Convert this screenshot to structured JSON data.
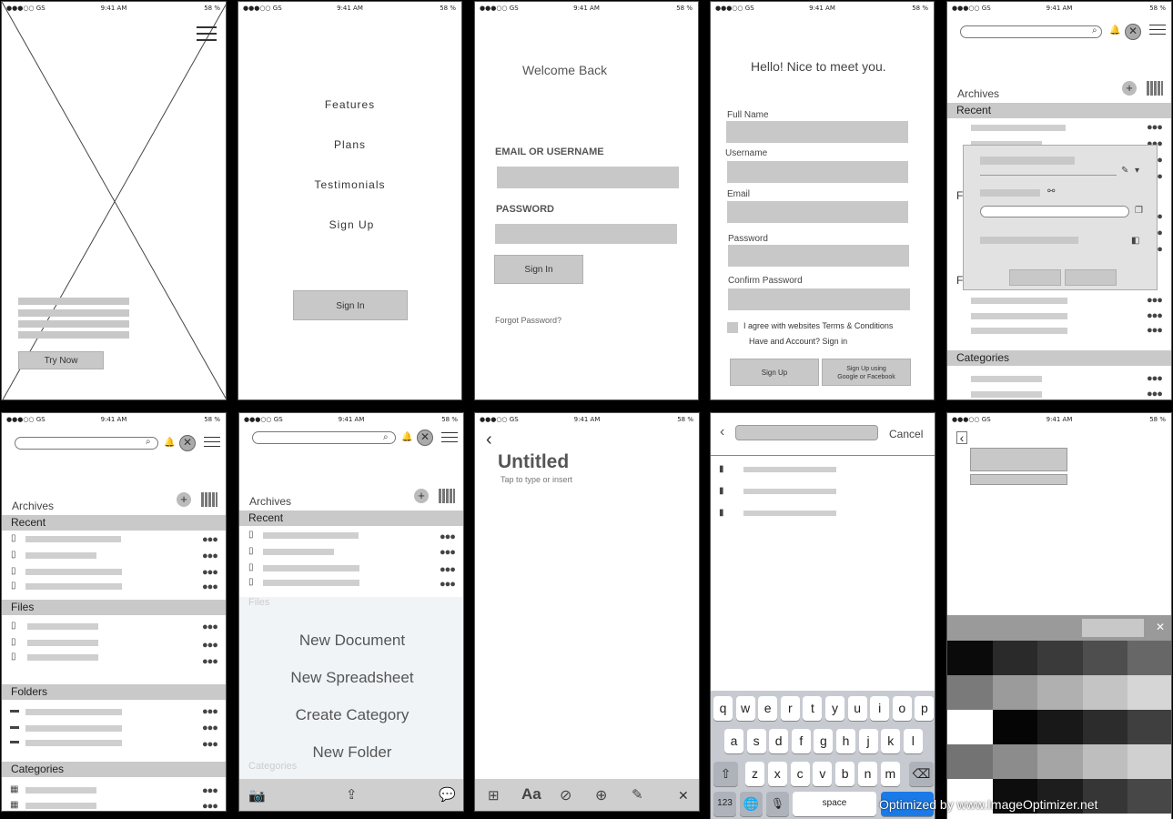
{
  "status": {
    "carrier": "●●●○○ GS",
    "time": "9:41 AM",
    "battery": "58 %"
  },
  "s1": {
    "try_now": "Try Now"
  },
  "s2": {
    "menu": [
      "Features",
      "Plans",
      "Testimonials",
      "Sign Up"
    ],
    "sign_in": "Sign In"
  },
  "s3": {
    "title": "Welcome Back",
    "email_label": "EMAIL OR USERNAME",
    "password_label": "PASSWORD",
    "sign_in": "Sign In",
    "forgot": "Forgot Password?"
  },
  "s4": {
    "title": "Hello! Nice to meet you.",
    "full_name": "Full Name",
    "username": "Username",
    "email": "Email",
    "password": "Password",
    "confirm": "Confirm Password",
    "agree": "I agree with websites Terms & Conditions",
    "have_account": "Have and Account? Sign in",
    "sign_up": "Sign Up",
    "sign_up_social": "Sign Up using\nGoogle or Facebook"
  },
  "archive": {
    "title": "Archives",
    "recent": "Recent",
    "files": "Files",
    "folders": "Folders",
    "categories": "Categories",
    "f_short": "F"
  },
  "s7": {
    "actions": [
      "New Document",
      "New Spreadsheet",
      "Create Category",
      "New Folder"
    ],
    "faded_files": "Files",
    "faded_categories": "Categories"
  },
  "s8": {
    "title": "Untitled",
    "hint": "Tap to type or insert",
    "back": "‹",
    "close": "✕"
  },
  "s9": {
    "cancel": "Cancel",
    "row1": [
      "q",
      "w",
      "e",
      "r",
      "t",
      "y",
      "u",
      "i",
      "o",
      "p"
    ],
    "row2": [
      "a",
      "s",
      "d",
      "f",
      "g",
      "h",
      "j",
      "k",
      "l"
    ],
    "row3": [
      "z",
      "x",
      "c",
      "v",
      "b",
      "n",
      "m"
    ],
    "k123": "123",
    "space": "space",
    "watermark": "Optimized by www.ImageOptimizer.net"
  },
  "s10": {
    "close": "✕",
    "back": "‹"
  },
  "colors": {
    "bar": "#c8c8c8",
    "section": "#c9c9c9",
    "bg": "#ffffff"
  }
}
